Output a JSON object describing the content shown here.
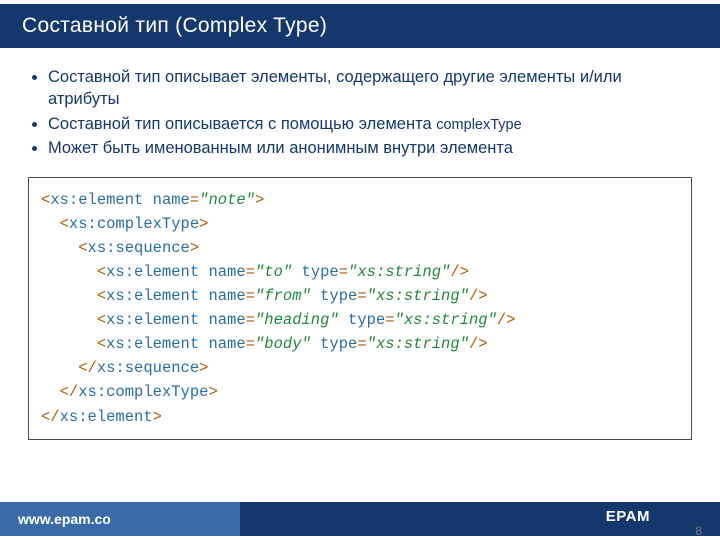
{
  "title": "Составной тип (Complex Type)",
  "bullets": [
    {
      "text": "Составной тип описывает элементы, содержащего  другие элементы и/или атрибуты"
    },
    {
      "text_a": "Составной тип описывается с помощью элемента ",
      "text_mono": "complexType"
    },
    {
      "text": "Может быть именованным или анонимным внутри элемента"
    }
  ],
  "code": {
    "lines": [
      {
        "indent": 0,
        "open": "<",
        "tag": "xs:element",
        "attrs": [
          {
            "name": "name",
            "value": "note"
          }
        ],
        "close": ">"
      },
      {
        "indent": 1,
        "open": "<",
        "tag": "xs:complexType",
        "attrs": [],
        "close": ">"
      },
      {
        "indent": 2,
        "open": "<",
        "tag": "xs:sequence",
        "attrs": [],
        "close": ">"
      },
      {
        "indent": 3,
        "open": "<",
        "tag": "xs:element",
        "attrs": [
          {
            "name": "name",
            "value": "to"
          },
          {
            "name": "type",
            "value": "xs:string"
          }
        ],
        "close": "/>"
      },
      {
        "indent": 3,
        "open": "<",
        "tag": "xs:element",
        "attrs": [
          {
            "name": "name",
            "value": "from"
          },
          {
            "name": "type",
            "value": "xs:string"
          }
        ],
        "close": "/>"
      },
      {
        "indent": 3,
        "open": "<",
        "tag": "xs:element",
        "attrs": [
          {
            "name": "name",
            "value": "heading"
          },
          {
            "name": "type",
            "value": "xs:string"
          }
        ],
        "close": "/>"
      },
      {
        "indent": 3,
        "open": "<",
        "tag": "xs:element",
        "attrs": [
          {
            "name": "name",
            "value": "body"
          },
          {
            "name": "type",
            "value": "xs:string"
          }
        ],
        "close": "/>"
      },
      {
        "indent": 2,
        "open": "</",
        "tag": "xs:sequence",
        "attrs": [],
        "close": ">"
      },
      {
        "indent": 1,
        "open": "</",
        "tag": "xs:complexType",
        "attrs": [],
        "close": ">"
      },
      {
        "indent": 0,
        "open": "</",
        "tag": "xs:element",
        "attrs": [],
        "close": ">"
      }
    ]
  },
  "footer": {
    "url": "www.epam.co",
    "brand": "EPAM"
  },
  "page_number": "8"
}
